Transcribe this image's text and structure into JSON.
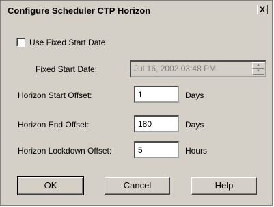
{
  "window": {
    "title": "Configure Scheduler CTP Horizon",
    "close_glyph": "X"
  },
  "options": {
    "use_fixed_start_label": "Use Fixed Start Date",
    "use_fixed_start_checked": false
  },
  "fixed_start": {
    "label": "Fixed Start Date:",
    "value": "Jul  16, 2002 03:48 PM",
    "disabled": true
  },
  "horizon_start": {
    "label": "Horizon Start Offset:",
    "value": "1",
    "unit": "Days"
  },
  "horizon_end": {
    "label": "Horizon End Offset:",
    "value": "180",
    "unit": "Days"
  },
  "horizon_lockdown": {
    "label": "Horizon Lockdown Offset:",
    "value": "5",
    "unit": "Hours"
  },
  "buttons": {
    "ok": "OK",
    "cancel": "Cancel",
    "help": "Help"
  }
}
